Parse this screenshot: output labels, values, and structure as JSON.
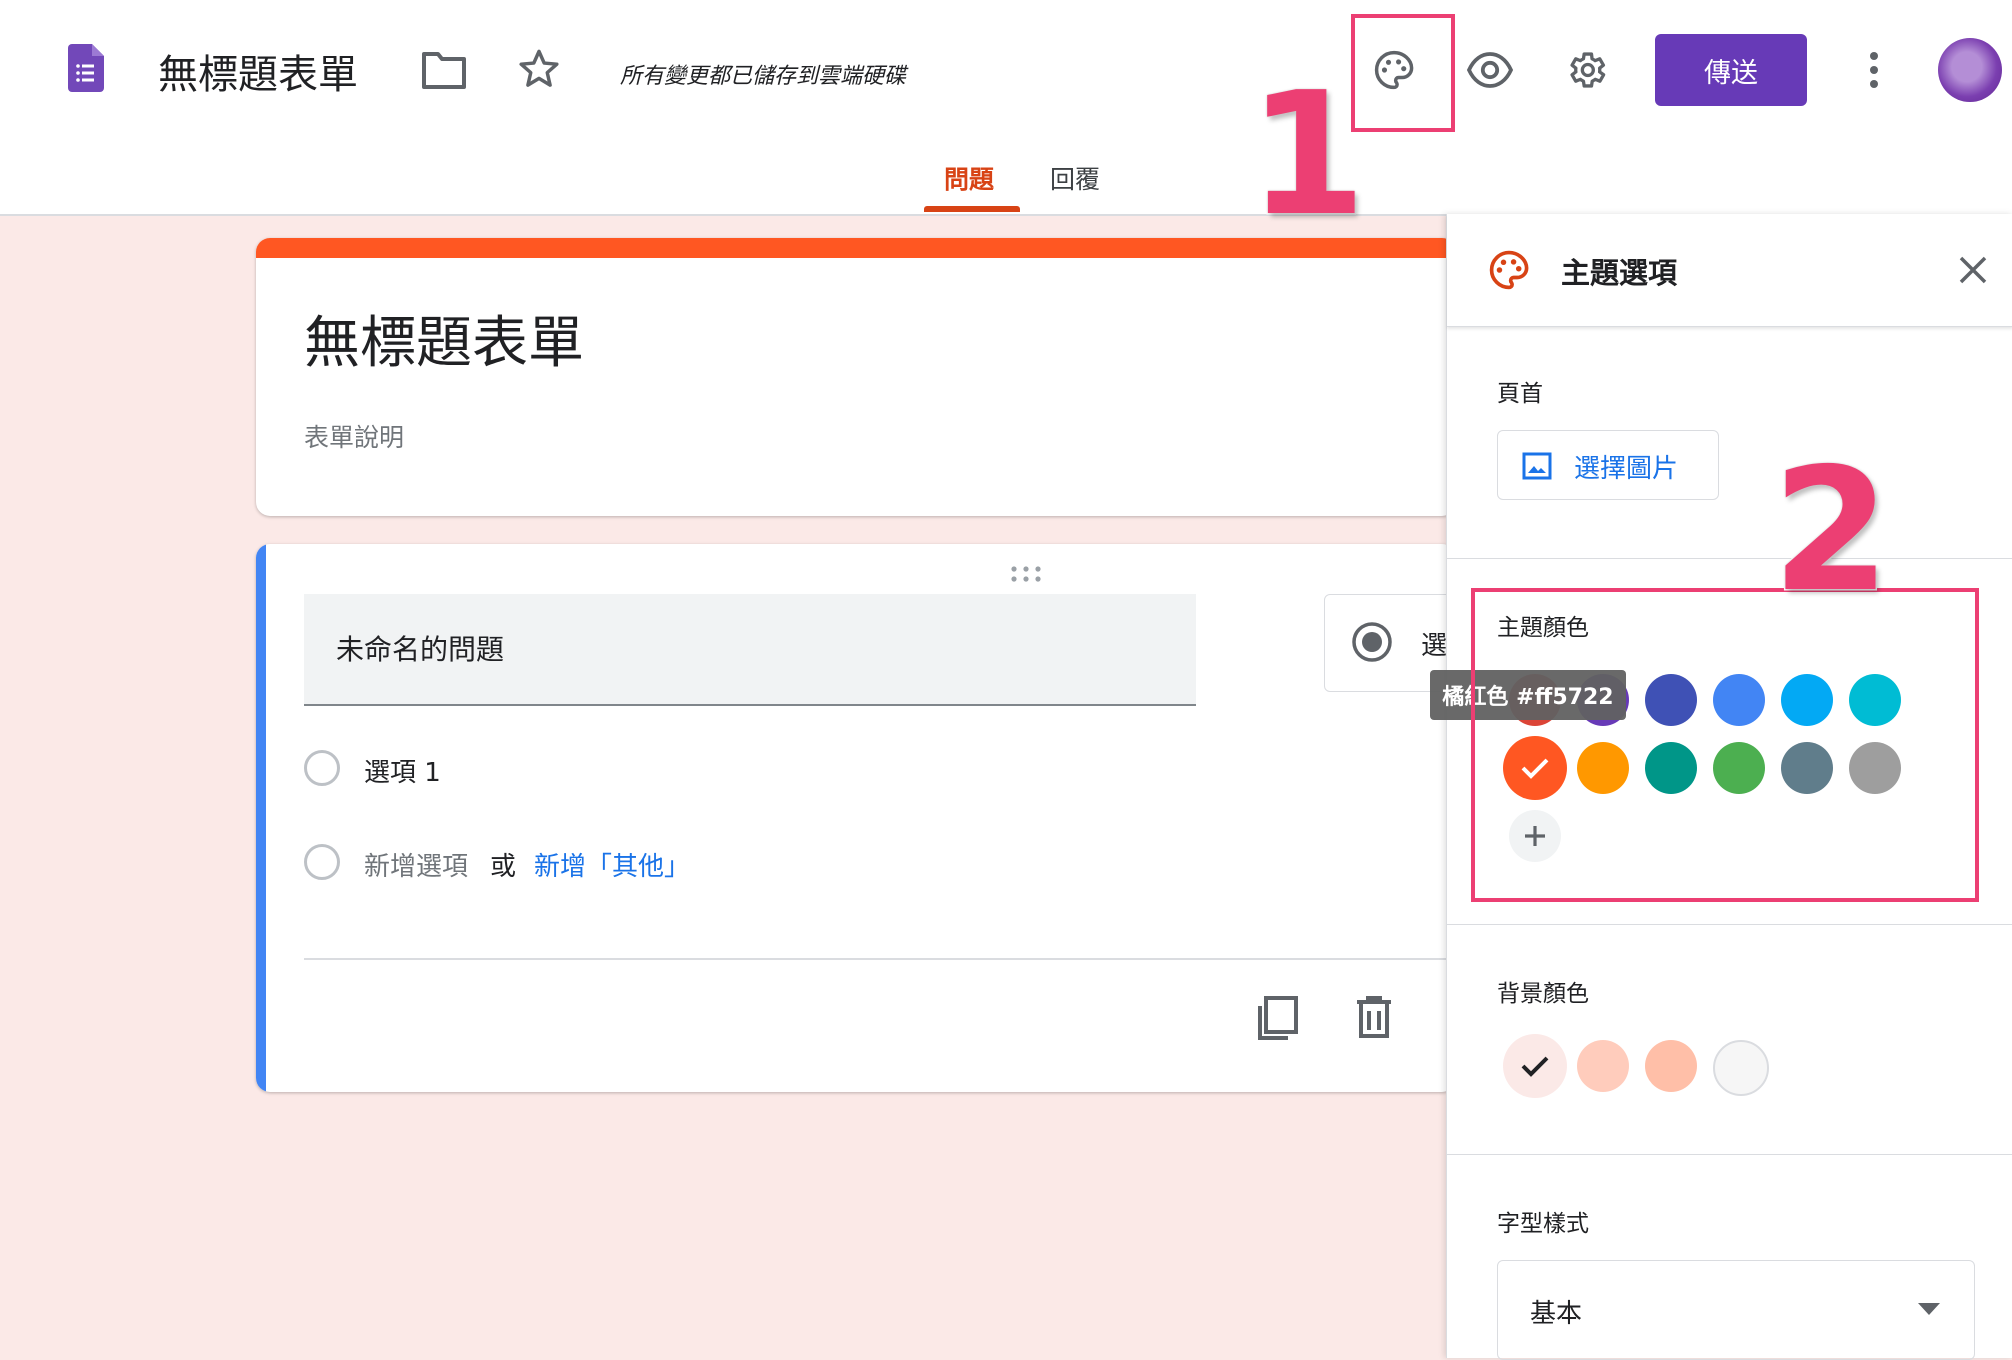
{
  "app": {
    "doc_title": "無標題表單",
    "save_status": "所有變更都已儲存到雲端硬碟",
    "send_label": "傳送",
    "brand_color": "#673ab7",
    "icons": [
      "forms-icon",
      "folder-icon",
      "star-icon",
      "palette-icon",
      "eye-icon",
      "gear-icon",
      "more-vert-icon"
    ]
  },
  "tabs": [
    {
      "label": "問題",
      "active": true
    },
    {
      "label": "回覆",
      "active": false
    }
  ],
  "annotations": {
    "marker_1": "1",
    "marker_2": "2",
    "color": "#ec3f73"
  },
  "form": {
    "title": "無標題表單",
    "description_placeholder": "表單說明",
    "question": {
      "title": "未命名的問題",
      "type_label": "選",
      "option_1": "選項 1",
      "add_option": "新增選項",
      "or": "或",
      "add_other": "新增「其他」"
    }
  },
  "theme_panel": {
    "title": "主題選項",
    "header_label": "頁首",
    "choose_image": "選擇圖片",
    "theme_color_label": "主題顏色",
    "tooltip": "橘紅色 #ff5722",
    "theme_colors": [
      {
        "color": "#db4437",
        "selected": false
      },
      {
        "color": "#673ab7",
        "selected": false
      },
      {
        "color": "#3f51b5",
        "selected": false
      },
      {
        "color": "#4285f4",
        "selected": false
      },
      {
        "color": "#03a9f4",
        "selected": false
      },
      {
        "color": "#00bcd4",
        "selected": false
      },
      {
        "color": "#ff5722",
        "selected": true
      },
      {
        "color": "#ff9800",
        "selected": false
      },
      {
        "color": "#009688",
        "selected": false
      },
      {
        "color": "#4caf50",
        "selected": false
      },
      {
        "color": "#607d8b",
        "selected": false
      },
      {
        "color": "#9e9e9e",
        "selected": false
      }
    ],
    "background_color_label": "背景顏色",
    "background_colors": [
      {
        "color": "#fbe9e7",
        "selected": true
      },
      {
        "color": "#ffccbc",
        "selected": false
      },
      {
        "color": "#ffbfa8",
        "selected": false
      },
      {
        "color": "#f6f6f6",
        "selected": false
      }
    ],
    "font_style_label": "字型樣式",
    "font_style_value": "基本"
  }
}
